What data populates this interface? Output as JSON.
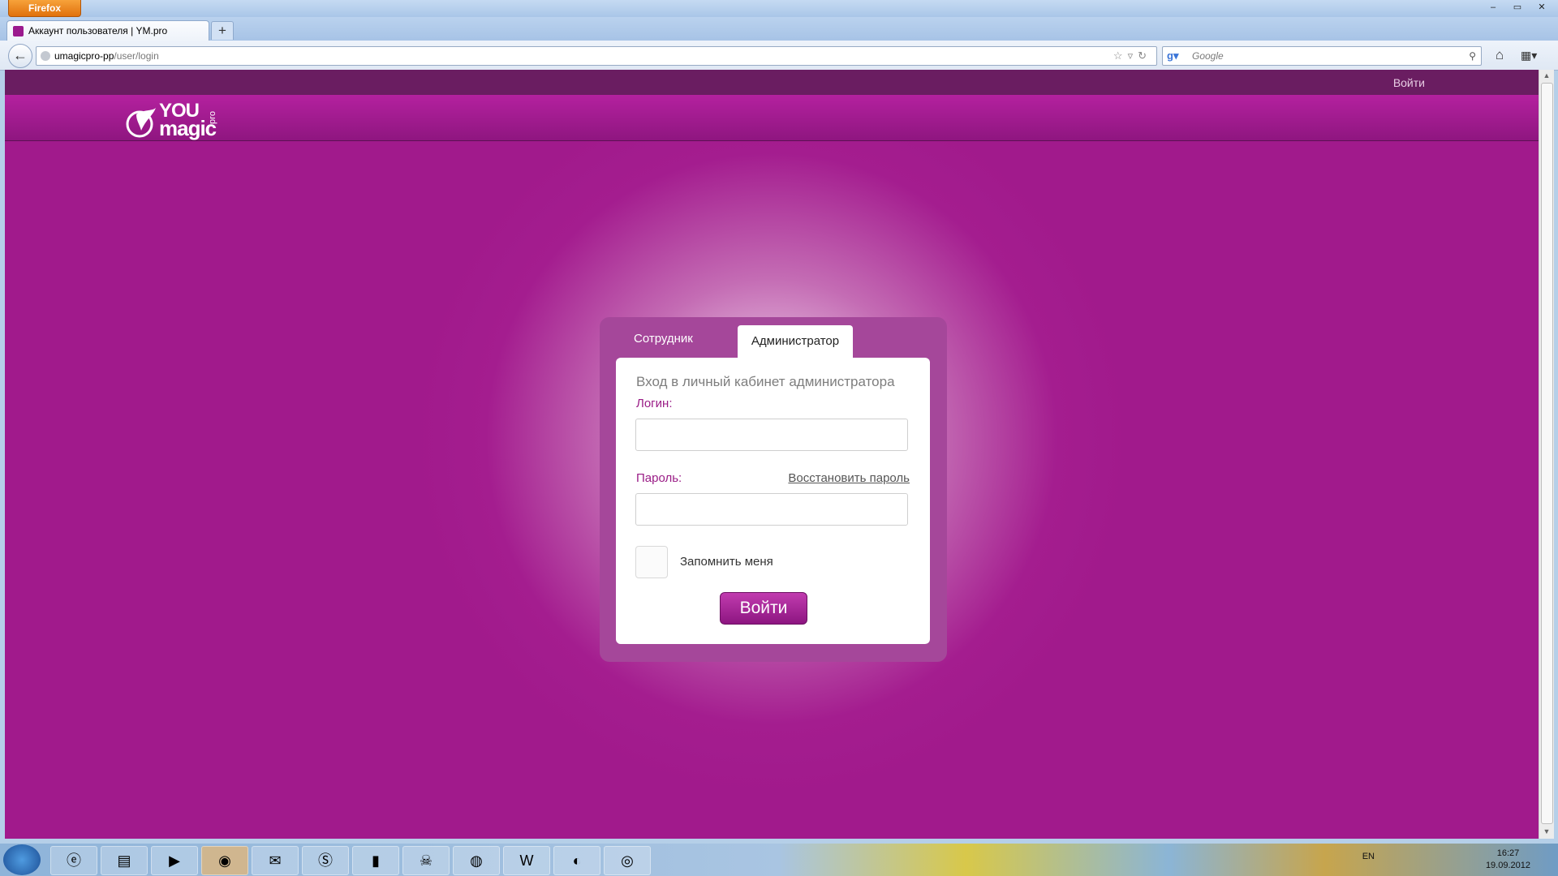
{
  "browser": {
    "menu_label": "Firefox",
    "tab_title": "Аккаунт пользователя | YM.pro",
    "new_tab": "+",
    "url_host": "umagicpro-pp",
    "url_path": "/user/login",
    "search_placeholder": "Google",
    "window_buttons": [
      "–",
      "▭",
      "✕"
    ]
  },
  "site": {
    "topnav_login": "Войти",
    "logo": {
      "you": "YOU",
      "magic": "magic",
      "pro": "pro"
    }
  },
  "login": {
    "tab_employee": "Сотрудник",
    "tab_admin": "Администратор",
    "heading": "Вход в личный кабинет администратора",
    "login_label": "Логин:",
    "password_label": "Пароль:",
    "restore_link": "Восстановить пароль",
    "remember_label": "Запомнить меня",
    "submit_label": "Войти"
  },
  "taskbar": {
    "apps": [
      "ie",
      "explorer",
      "media-player",
      "firefox",
      "outlook",
      "skype",
      "cmd",
      "alien",
      "network",
      "word",
      "eclipse",
      "lastfm"
    ],
    "lang": "EN",
    "time": "16:27",
    "date": "19.09.2012"
  },
  "colors": {
    "brand": "#a41d8f",
    "topnav": "#6a1d61",
    "box": "#a5479a"
  }
}
